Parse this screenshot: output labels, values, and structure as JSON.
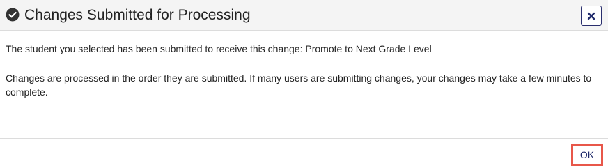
{
  "dialog": {
    "title": "Changes Submitted for Processing",
    "title_icon": "check-circle-icon",
    "close_icon": "close-icon",
    "message_line1": "The student you selected has been submitted to receive this change: Promote to Next Grade Level",
    "message_line2": "Changes are processed in the order they are submitted. If many users are submitting changes, your changes may take a few minutes to complete.",
    "ok_label": "OK"
  },
  "colors": {
    "header_bg": "#f4f4f4",
    "accent_navy": "#1f2a6b",
    "highlight_red": "#e8574a"
  }
}
